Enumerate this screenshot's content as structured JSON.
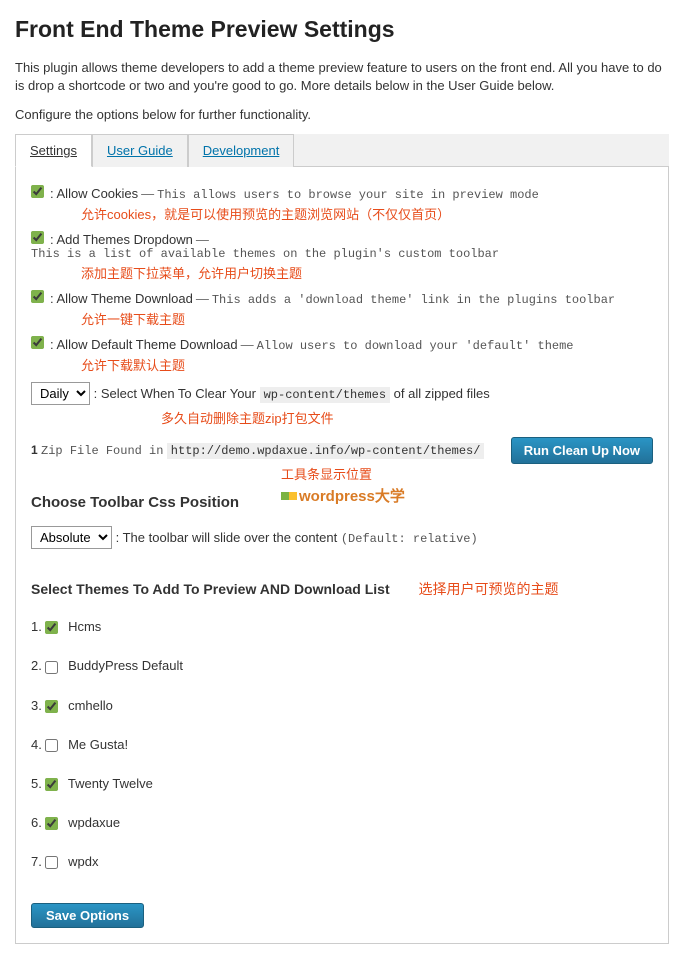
{
  "title": "Front End Theme Preview Settings",
  "intro": "This plugin allows theme developers to add a theme preview feature to users on the front end. All you have to do is drop a shortcode or two and you're good to go. More details below in the User Guide below.",
  "configure": "Configure the options below for further functionality.",
  "tabs": {
    "settings": "Settings",
    "user_guide": "User Guide",
    "development": "Development"
  },
  "options": {
    "allow_cookies": {
      "checked": true,
      "label": ": Allow Cookies",
      "desc": "This allows users to browse your site in preview mode",
      "annotation": "允许cookies，就是可以使用预览的主题浏览网站（不仅仅首页）"
    },
    "add_dropdown": {
      "checked": true,
      "label": ": Add Themes Dropdown",
      "desc": "This is a list of available themes on the plugin's custom toolbar",
      "annotation": "添加主题下拉菜单，允许用户切换主题"
    },
    "allow_download": {
      "checked": true,
      "label": ": Allow Theme Download",
      "desc": "This adds a 'download theme' link in the plugins toolbar",
      "annotation": "允许一键下载主题"
    },
    "allow_default_download": {
      "checked": true,
      "label": ": Allow Default Theme Download",
      "desc": "Allow users to download your 'default' theme",
      "annotation": "允许下载默认主题"
    }
  },
  "clear_schedule": {
    "selected": "Daily",
    "label": ": Select When To Clear Your",
    "path": "wp-content/themes",
    "suffix": "of all zipped files",
    "annotation": "多久自动删除主题zip打包文件"
  },
  "cleanup": {
    "zip_count": "1",
    "zip_text": "Zip File Found in",
    "zip_path": "http://demo.wpdaxue.info/wp-content/themes/",
    "button": "Run Clean Up Now"
  },
  "toolbar_section": {
    "title": "Choose Toolbar Css Position",
    "annotation": "工具条显示位置",
    "watermark": "wordpress大学",
    "selected": "Absolute",
    "desc": ": The toolbar will slide over the content",
    "default_note": "(Default: relative)"
  },
  "themes_section": {
    "title": "Select Themes To Add To Preview AND Download List",
    "annotation": "选择用户可预览的主题",
    "items": [
      {
        "num": "1.",
        "checked": true,
        "name": "Hcms"
      },
      {
        "num": "2.",
        "checked": false,
        "name": "BuddyPress Default"
      },
      {
        "num": "3.",
        "checked": true,
        "name": "cmhello"
      },
      {
        "num": "4.",
        "checked": false,
        "name": "Me Gusta!"
      },
      {
        "num": "5.",
        "checked": true,
        "name": "Twenty Twelve"
      },
      {
        "num": "6.",
        "checked": true,
        "name": "wpdaxue"
      },
      {
        "num": "7.",
        "checked": false,
        "name": "wpdx"
      }
    ]
  },
  "save_button": "Save Options"
}
